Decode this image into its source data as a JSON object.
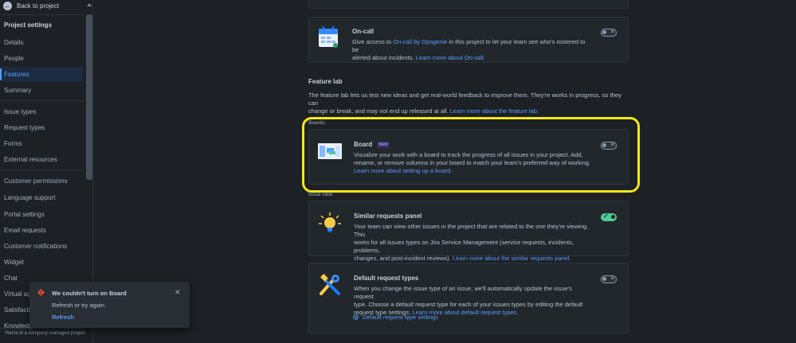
{
  "sidebar": {
    "back_label": "Back to project",
    "section_title": "Project settings",
    "items": [
      {
        "label": "Details"
      },
      {
        "label": "People"
      },
      {
        "label": "Features",
        "active": true
      },
      {
        "label": "Summary"
      },
      {
        "label": "Issue types"
      },
      {
        "label": "Request types"
      },
      {
        "label": "Forms"
      },
      {
        "label": "External resources"
      },
      {
        "label": "Customer permissions"
      },
      {
        "label": "Language support"
      },
      {
        "label": "Portal settings"
      },
      {
        "label": "Email requests"
      },
      {
        "label": "Customer notifications"
      },
      {
        "label": "Widget"
      },
      {
        "label": "Chat"
      },
      {
        "label": "Virtual agent"
      },
      {
        "label": "Satisfaction"
      },
      {
        "label": "Knowledge"
      }
    ],
    "footer_note": "You're in a company-managed project"
  },
  "oncall": {
    "title": "On-call",
    "desc_1": "Give access to ",
    "link_1": "On-call by Opsgenie",
    "desc_2": " in this project to let your team see who's rostered to be",
    "desc_3": "alerted about incidents. ",
    "link_2": "Learn more about On-call.",
    "enabled": false
  },
  "feature_lab": {
    "title": "Feature lab",
    "text_1": "The feature lab lets us test new ideas and get real-world feedback to improve them. They're works in progress, so they can",
    "text_2": "change or break, and may not end up released at all. ",
    "link": "Learn more about the feature lab."
  },
  "boards_label": "Boards",
  "board": {
    "title": "Board",
    "badge": "NEW",
    "desc_1": "Visualize your work with a board to track the progress of all issues in your project. Add,",
    "desc_2": "rename, or remove columns in your board to match your team's preferred way of working.",
    "link": "Learn more about setting up a board.",
    "enabled": false
  },
  "issue_view_label": "Issue view",
  "similar": {
    "title": "Similar requests panel",
    "desc_1": "Your team can view other issues in the project that are related to the one they're viewing. This",
    "desc_2": "works for all issues types on Jira Service Management (service requests, incidents, problems,",
    "desc_3": "changes, and post-incident reviews). ",
    "link": "Learn more about the similar requests panel.",
    "enabled": true
  },
  "default_types": {
    "title": "Default request types",
    "desc_1": "When you change the issue type of an issue, we'll automatically update the issue's request",
    "desc_2": "type. Choose a default request type for each of your issues types by editing the default",
    "desc_3": "request type settings. ",
    "link": "Learn more about default request types.",
    "settings_link": "Default request type settings",
    "enabled": false
  },
  "toast": {
    "title": "We couldn't turn on Board",
    "body": "Refresh or try again.",
    "action": "Refresh"
  },
  "colors": {
    "accent": "#579dff",
    "highlight": "#f2e815",
    "toggle_on": "#4bce97",
    "error": "#e34935"
  }
}
